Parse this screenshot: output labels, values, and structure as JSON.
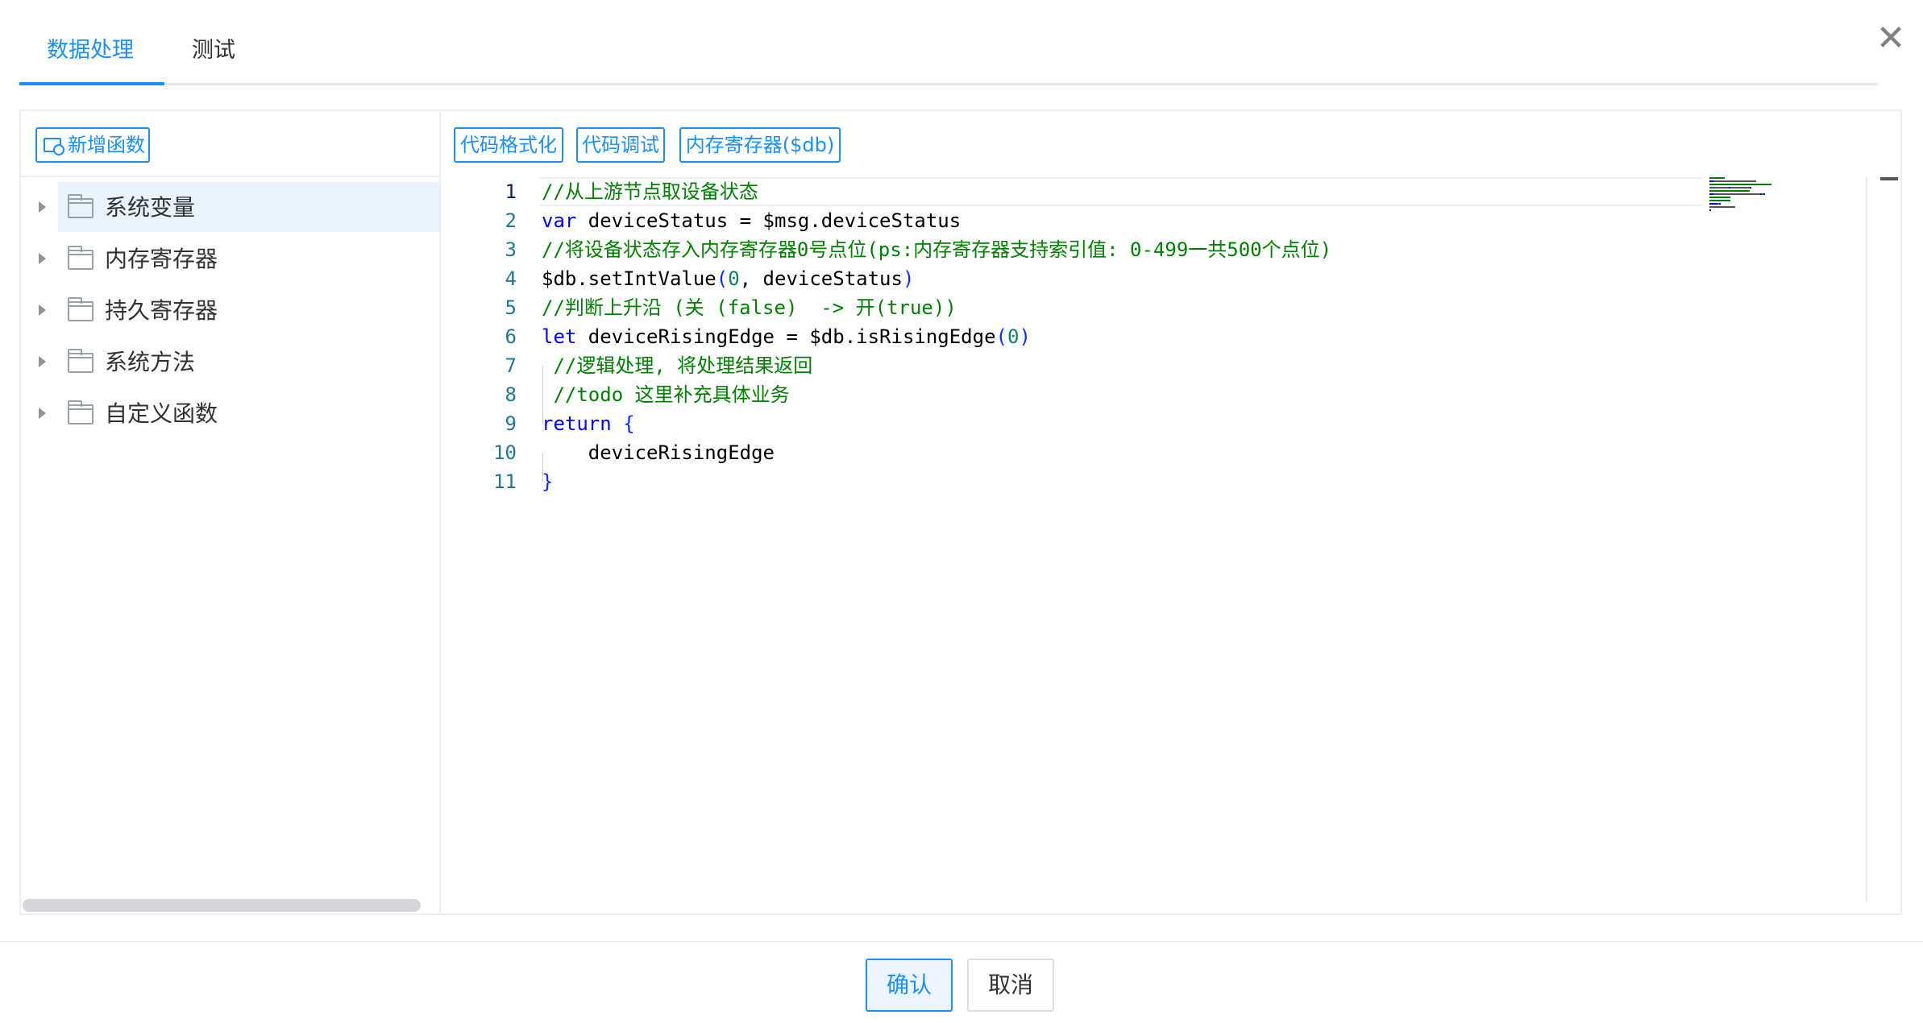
{
  "tabs": [
    {
      "label": "数据处理",
      "active": true
    },
    {
      "label": "测试",
      "active": false
    }
  ],
  "close_glyph": "✕",
  "left_toolbar": {
    "add_function_label": "新增函数",
    "add_function_icon": "image-add-icon"
  },
  "tree": [
    {
      "label": "系统变量",
      "selected": true
    },
    {
      "label": "内存寄存器",
      "selected": false
    },
    {
      "label": "持久寄存器",
      "selected": false
    },
    {
      "label": "系统方法",
      "selected": false
    },
    {
      "label": "自定义函数",
      "selected": false
    }
  ],
  "editor_toolbar": {
    "format_label": "代码格式化",
    "debug_label": "代码调试",
    "memory_label": "内存寄存器($db)"
  },
  "code": {
    "current_line": 1,
    "lines": [
      {
        "n": "1",
        "tokens": [
          {
            "t": "cm",
            "v": "//从上游节点取设备状态"
          }
        ]
      },
      {
        "n": "2",
        "tokens": [
          {
            "t": "kw",
            "v": "var"
          },
          {
            "t": "tx",
            "v": " deviceStatus = $msg.deviceStatus"
          }
        ]
      },
      {
        "n": "3",
        "tokens": [
          {
            "t": "cm",
            "v": "//将设备状态存入内存寄存器0号点位(ps:内存寄存器支持索引值: 0-499一共500个点位)"
          }
        ]
      },
      {
        "n": "4",
        "tokens": [
          {
            "t": "tx",
            "v": "$db.setIntValue"
          },
          {
            "t": "br",
            "v": "("
          },
          {
            "t": "num",
            "v": "0"
          },
          {
            "t": "tx",
            "v": ", deviceStatus"
          },
          {
            "t": "br",
            "v": ")"
          }
        ]
      },
      {
        "n": "5",
        "tokens": [
          {
            "t": "cm",
            "v": "//判断上升沿 (关 (false)  -> 开(true))"
          }
        ]
      },
      {
        "n": "6",
        "tokens": [
          {
            "t": "kw",
            "v": "let"
          },
          {
            "t": "tx",
            "v": " deviceRisingEdge = $db.isRisingEdge"
          },
          {
            "t": "br",
            "v": "("
          },
          {
            "t": "num",
            "v": "0"
          },
          {
            "t": "br",
            "v": ")"
          }
        ]
      },
      {
        "n": "7",
        "tokens": [
          {
            "t": "cm",
            "v": " //逻辑处理, 将处理结果返回"
          }
        ]
      },
      {
        "n": "8",
        "tokens": [
          {
            "t": "cm",
            "v": " //todo 这里补充具体业务"
          }
        ]
      },
      {
        "n": "9",
        "tokens": [
          {
            "t": "kw",
            "v": "return"
          },
          {
            "t": "tx",
            "v": " "
          },
          {
            "t": "br",
            "v": "{"
          }
        ]
      },
      {
        "n": "10",
        "tokens": [
          {
            "t": "tx",
            "v": "    deviceRisingEdge"
          }
        ]
      },
      {
        "n": "11",
        "tokens": [
          {
            "t": "br",
            "v": "}"
          }
        ]
      }
    ]
  },
  "footer": {
    "confirm_label": "确认",
    "cancel_label": "取消"
  },
  "colors": {
    "accent": "#1890ff",
    "comment": "#008000",
    "keyword": "#0000ff",
    "number": "#098658",
    "line_number": "#237893"
  }
}
